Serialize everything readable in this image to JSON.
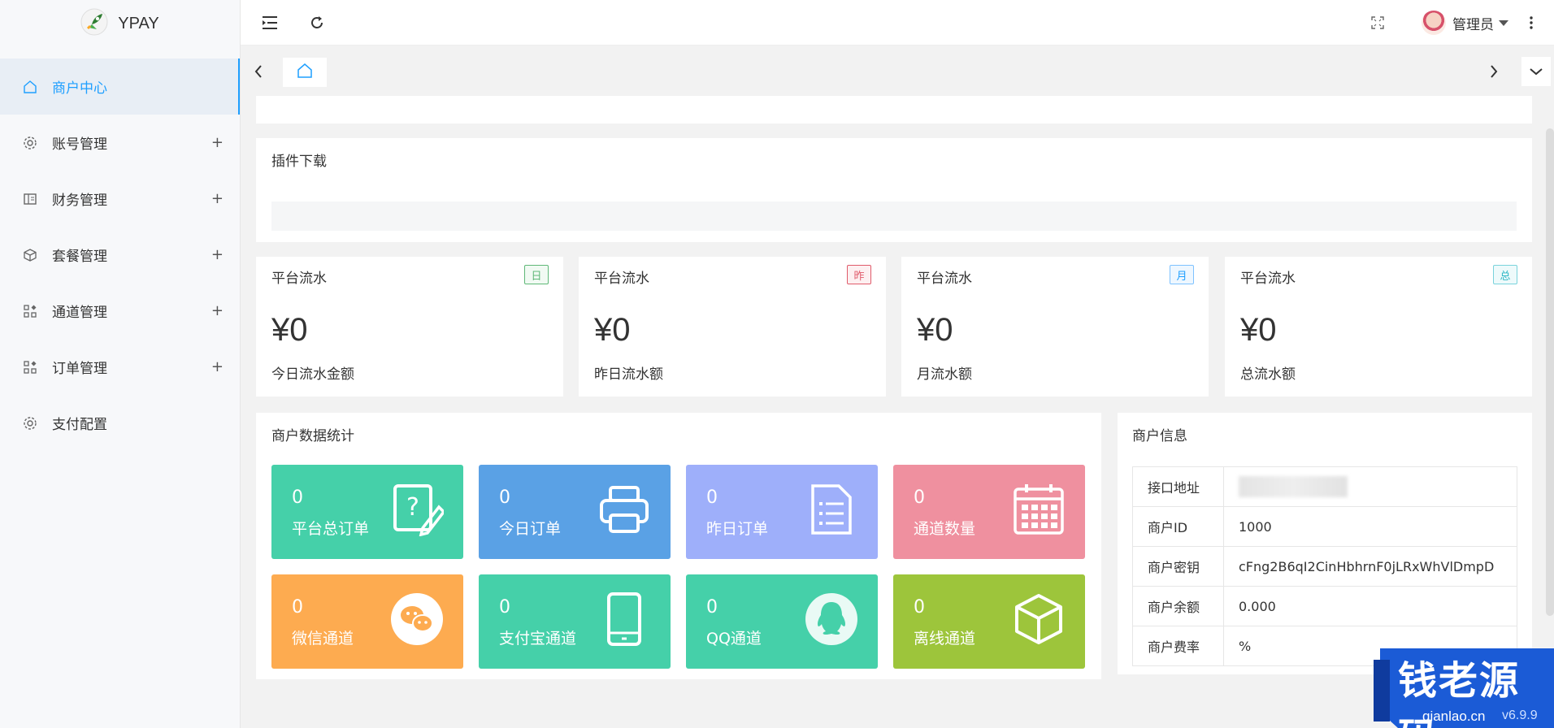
{
  "app": {
    "title": "YPAY"
  },
  "sidebar": {
    "items": [
      {
        "label": "商户中心",
        "icon": "home-icon",
        "expandable": false,
        "active": true
      },
      {
        "label": "账号管理",
        "icon": "gear-icon",
        "expandable": true,
        "active": false
      },
      {
        "label": "财务管理",
        "icon": "ledger-icon",
        "expandable": true,
        "active": false
      },
      {
        "label": "套餐管理",
        "icon": "box-icon",
        "expandable": true,
        "active": false
      },
      {
        "label": "通道管理",
        "icon": "apps-icon",
        "expandable": true,
        "active": false
      },
      {
        "label": "订单管理",
        "icon": "apps-icon",
        "expandable": true,
        "active": false
      },
      {
        "label": "支付配置",
        "icon": "gear-icon",
        "expandable": false,
        "active": false
      }
    ],
    "plus_symbol": "+"
  },
  "header": {
    "user": "管理员"
  },
  "sections": {
    "plugin_title": "插件下载",
    "merchant_stats_title": "商户数据统计",
    "merchant_info_title": "商户信息"
  },
  "stat_cards": [
    {
      "title": "平台流水",
      "badge": "日",
      "amount": "¥0",
      "desc": "今日流水金额",
      "badge_color": "#5fb878"
    },
    {
      "title": "平台流水",
      "badge": "昨",
      "amount": "¥0",
      "desc": "昨日流水额",
      "badge_color": "#e05b6b"
    },
    {
      "title": "平台流水",
      "badge": "月",
      "amount": "¥0",
      "desc": "月流水额",
      "badge_color": "#1e9fff"
    },
    {
      "title": "平台流水",
      "badge": "总",
      "amount": "¥0",
      "desc": "总流水额",
      "badge_color": "#2db7c5"
    }
  ],
  "tiles": [
    {
      "value": "0",
      "label": "平台总订单",
      "color": "#45d0a9",
      "icon": "edit-document-icon"
    },
    {
      "value": "0",
      "label": "今日订单",
      "color": "#5aa1e5",
      "icon": "printer-icon"
    },
    {
      "value": "0",
      "label": "昨日订单",
      "color": "#9eaffa",
      "icon": "list-document-icon"
    },
    {
      "value": "0",
      "label": "通道数量",
      "color": "#ef909f",
      "icon": "calendar-icon"
    },
    {
      "value": "0",
      "label": "微信通道",
      "color": "#fdab50",
      "icon": "wechat-icon"
    },
    {
      "value": "0",
      "label": "支付宝通道",
      "color": "#45d0a9",
      "icon": "phone-icon"
    },
    {
      "value": "0",
      "label": "QQ通道",
      "color": "#45d0a9",
      "icon": "qq-icon"
    },
    {
      "value": "0",
      "label": "离线通道",
      "color": "#9dc53b",
      "icon": "cube-icon"
    }
  ],
  "merchant_info": [
    {
      "key": "接口地址",
      "value": ""
    },
    {
      "key": "商户ID",
      "value": "1000"
    },
    {
      "key": "商户密钥",
      "value": "cFng2B6qI2CinHbhrnF0jLRxWhVlDmpD"
    },
    {
      "key": "商户余额",
      "value": "0.000"
    },
    {
      "key": "商户费率",
      "value": "%"
    }
  ],
  "watermark": {
    "text": "钱老源码",
    "url": "qianlao.cn",
    "version": "v6.9.9"
  }
}
